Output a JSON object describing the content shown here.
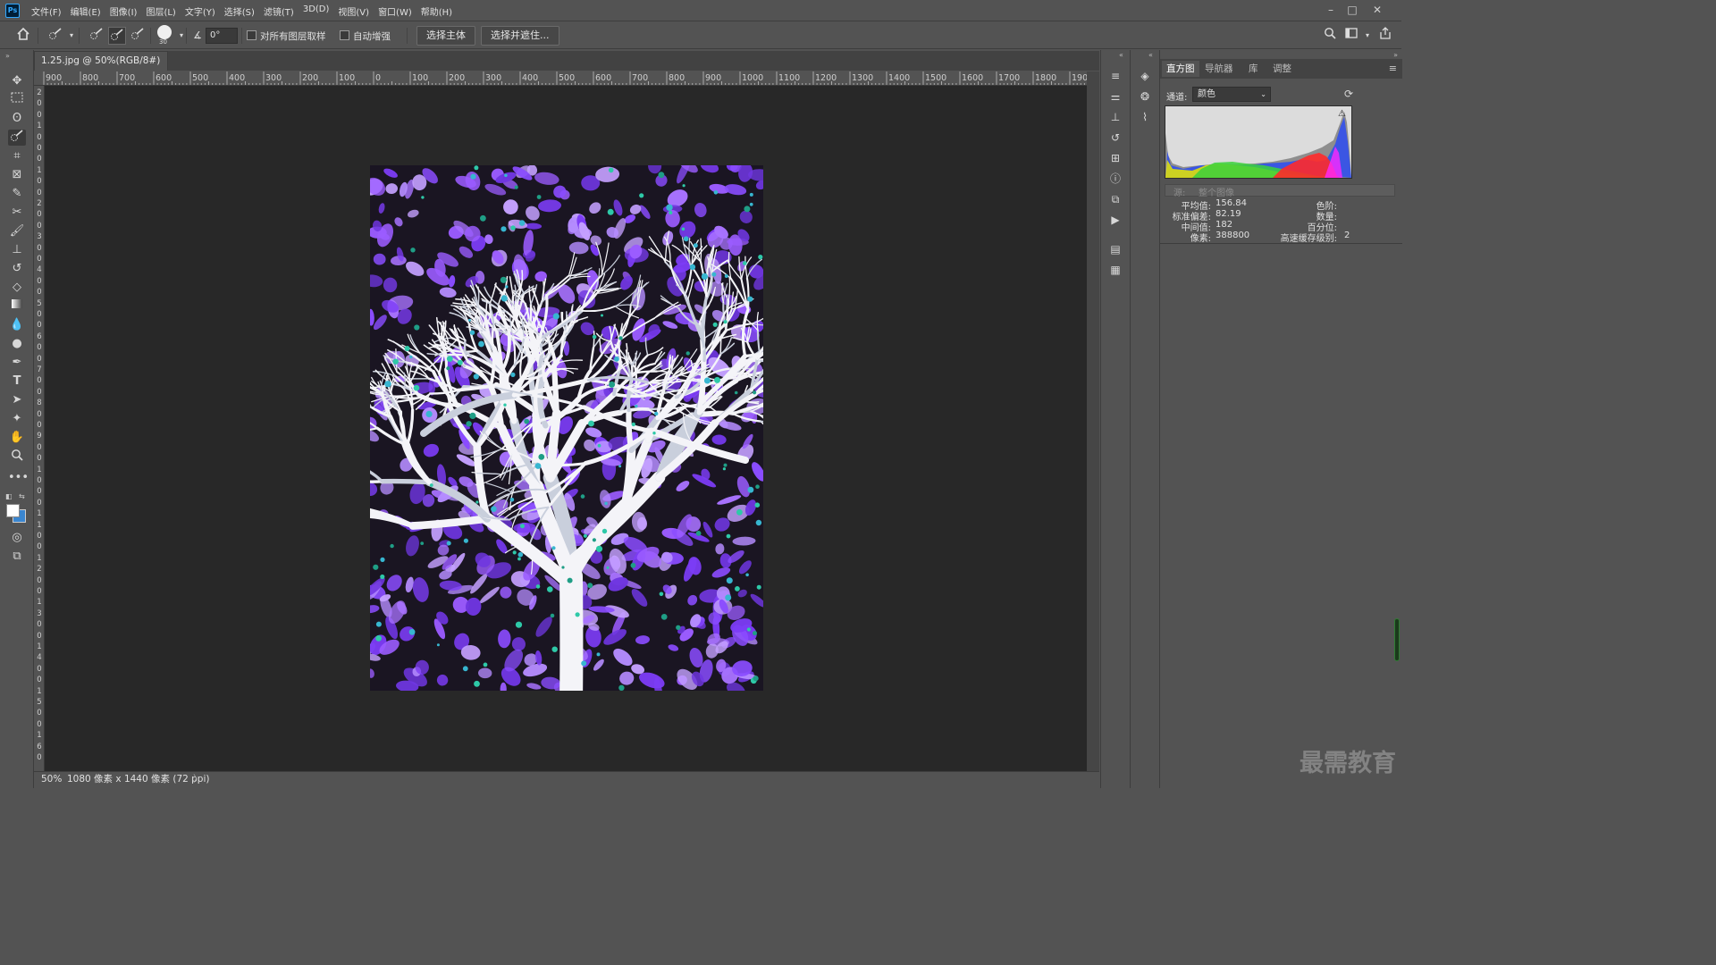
{
  "app": {
    "logo": "Ps"
  },
  "menu": [
    "文件(F)",
    "编辑(E)",
    "图像(I)",
    "图层(L)",
    "文字(Y)",
    "选择(S)",
    "滤镜(T)",
    "3D(D)",
    "视图(V)",
    "窗口(W)",
    "帮助(H)"
  ],
  "window_controls": {
    "minimize": "–",
    "restore": "□",
    "close": "✕"
  },
  "options_bar": {
    "brush_size": "30",
    "angle_value": "0°",
    "sample_all_layers_label": "对所有图层取样",
    "sample_all_layers_checked": false,
    "auto_enhance_label": "自动增强",
    "auto_enhance_checked": false,
    "select_subject_label": "选择主体",
    "select_and_mask_label": "选择并遮住..."
  },
  "document": {
    "tab_title": "1.25.jpg @ 50%(RGB/8#) *",
    "close_glyph": "×",
    "zoom": "50%",
    "info": "1080 像素 x 1440 像素 (72 ppi)",
    "info_arrow": "〉"
  },
  "ruler_h_labels": [
    "900",
    "800",
    "700",
    "600",
    "500",
    "400",
    "300",
    "200",
    "100",
    "0",
    "100",
    "200",
    "300",
    "400",
    "500",
    "600",
    "700",
    "800",
    "900",
    "1000",
    "1100",
    "1200",
    "1300",
    "1400",
    "1500",
    "1600",
    "1700",
    "1800",
    "1900"
  ],
  "ruler_v_labels": [
    "2",
    "0",
    "0",
    "1",
    "0",
    "0",
    "0",
    "1",
    "0",
    "0",
    "2",
    "0",
    "0",
    "3",
    "0",
    "0",
    "4",
    "0",
    "0",
    "5",
    "0",
    "0",
    "6",
    "0",
    "0",
    "7",
    "0",
    "0",
    "8",
    "0",
    "0",
    "9",
    "0",
    "0",
    "1",
    "0",
    "0",
    "0",
    "1",
    "1",
    "0",
    "0",
    "1",
    "2",
    "0",
    "0",
    "1",
    "3",
    "0",
    "0",
    "1",
    "4",
    "0",
    "0",
    "1",
    "5",
    "0",
    "0",
    "1",
    "6",
    "0"
  ],
  "panel": {
    "tabs": [
      "直方图",
      "导航器",
      "库",
      "调整"
    ],
    "active_tab": "直方图",
    "channel_label": "通道:",
    "channel_value": "颜色",
    "source_label": "源:",
    "source_value": "整个图像",
    "stats": {
      "mean_label": "平均值:",
      "mean": "156.84",
      "std_label": "标准偏差:",
      "std": "82.19",
      "median_label": "中间值:",
      "median": "182",
      "pixels_label": "像素:",
      "pixels": "388800",
      "level_label": "色阶:",
      "level": "",
      "count_label": "数量:",
      "count": "",
      "percentile_label": "百分位:",
      "percentile": "",
      "cache_label": "高速缓存级别:",
      "cache": "2"
    }
  },
  "watermark": "最需教育",
  "colors": {
    "ui_bg": "#535353",
    "canvas_bg": "#282828",
    "accent_blue": "#31a8ff",
    "image_purple": "#8a4cff"
  }
}
